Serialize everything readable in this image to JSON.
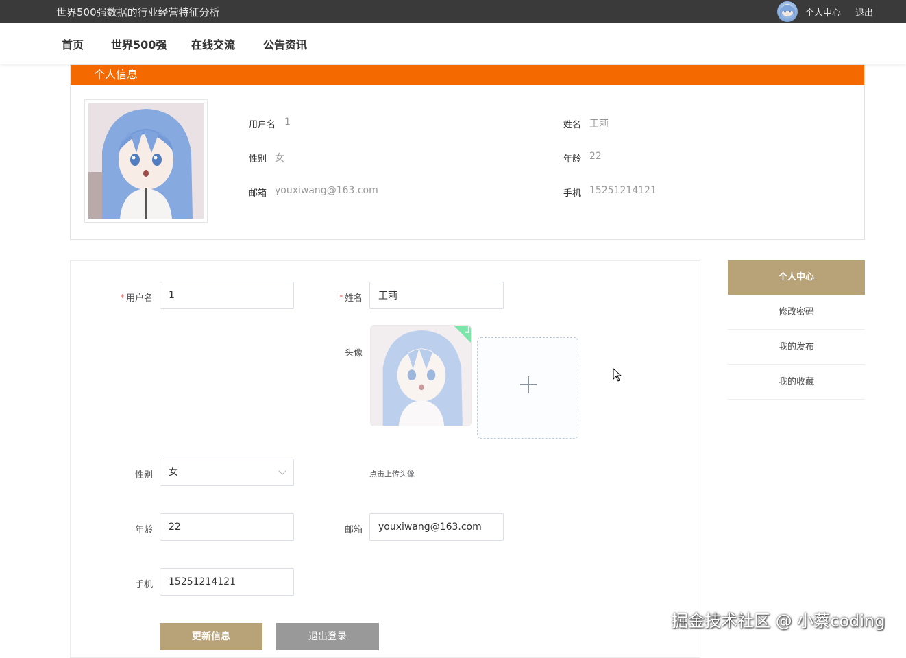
{
  "topbar": {
    "site_title": "世界500强数据的行业经营特征分析",
    "personal_center": "个人中心",
    "logout": "退出"
  },
  "nav": {
    "items": [
      {
        "label": "首页"
      },
      {
        "label": "世界500强"
      },
      {
        "label": "在线交流"
      },
      {
        "label": "公告资讯"
      }
    ]
  },
  "profile": {
    "header": "个人信息",
    "username_label": "用户名",
    "username": "1",
    "name_label": "姓名",
    "name": "王莉",
    "gender_label": "性别",
    "gender": "女",
    "age_label": "年龄",
    "age": "22",
    "email_label": "邮箱",
    "email": "youxiwang@163.com",
    "phone_label": "手机",
    "phone": "15251214121"
  },
  "form": {
    "username_label": "用户名",
    "username_value": "1",
    "name_label": "姓名",
    "name_value": "王莉",
    "avatar_label": "头像",
    "upload_tip": "点击上传头像",
    "gender_label": "性别",
    "gender_value": "女",
    "age_label": "年龄",
    "age_value": "22",
    "email_label": "邮箱",
    "email_value": "youxiwang@163.com",
    "phone_label": "手机",
    "phone_value": "15251214121",
    "update_button": "更新信息",
    "logout_button": "退出登录"
  },
  "side_menu": {
    "items": [
      {
        "label": "个人中心",
        "active": true
      },
      {
        "label": "修改密码"
      },
      {
        "label": "我的发布"
      },
      {
        "label": "我的收藏"
      }
    ]
  },
  "watermark": "掘金技术社区 @ 小蔡coding",
  "colors": {
    "accent_orange": "#f56a00",
    "side_active": "#b8a277",
    "btn_primary": "#b8a277",
    "btn_secondary": "#999999",
    "topbar": "#3a3a3a"
  }
}
